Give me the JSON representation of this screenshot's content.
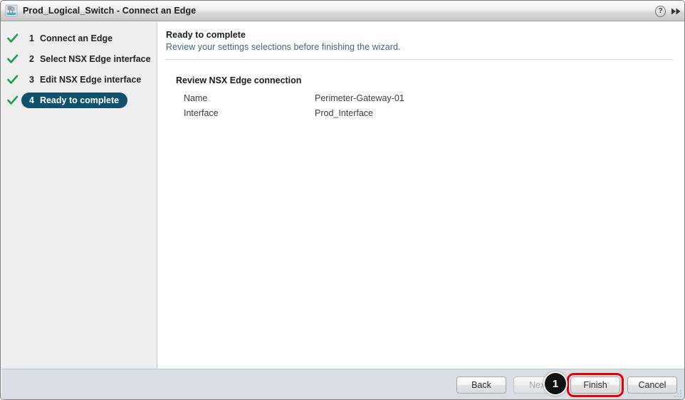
{
  "window": {
    "title": "Prod_Logical_Switch - Connect an Edge",
    "title_icon": "logical-switch-icon",
    "help_label": "?",
    "expand_label": "▶▶"
  },
  "sidebar": {
    "steps": [
      {
        "number": "1",
        "label": "Connect an Edge",
        "state": "complete"
      },
      {
        "number": "2",
        "label": "Select NSX Edge interface",
        "state": "complete"
      },
      {
        "number": "3",
        "label": "Edit NSX Edge interface",
        "state": "complete"
      },
      {
        "number": "4",
        "label": "Ready to complete",
        "state": "active"
      }
    ]
  },
  "content": {
    "title": "Ready to complete",
    "subtitle": "Review your settings selections before finishing the wizard.",
    "review_heading": "Review NSX Edge connection",
    "rows": [
      {
        "label": "Name",
        "value": "Perimeter-Gateway-01"
      },
      {
        "label": "Interface",
        "value": "Prod_Interface"
      }
    ]
  },
  "footer": {
    "buttons": [
      {
        "label": "Back",
        "state": "enabled",
        "highlighted": false
      },
      {
        "label": "Next",
        "state": "disabled",
        "highlighted": false
      },
      {
        "label": "Finish",
        "state": "enabled",
        "highlighted": true
      },
      {
        "label": "Cancel",
        "state": "enabled",
        "highlighted": false
      }
    ]
  },
  "annotation": {
    "badge_number": "1"
  },
  "colors": {
    "active_step": "#10526b",
    "checkmark_green": "#1ba14e",
    "highlight_red": "#e60000",
    "subtitle_blue": "#41667d",
    "footer_bg": "#d8dee3",
    "sidebar_bg": "#eeeeee"
  }
}
